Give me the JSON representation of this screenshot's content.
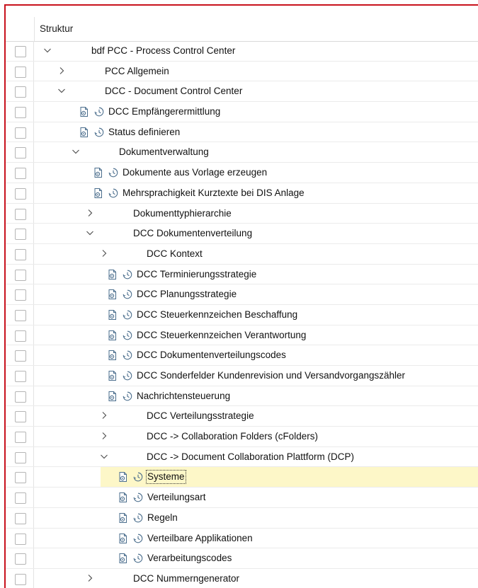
{
  "header": {
    "column_title": "Struktur"
  },
  "rows": [
    {
      "level": 0,
      "type": "folder",
      "expanded": true,
      "label": "bdf PCC - Process Control Center"
    },
    {
      "level": 1,
      "type": "folder",
      "expanded": false,
      "label": "PCC Allgemein"
    },
    {
      "level": 1,
      "type": "folder",
      "expanded": true,
      "label": "DCC - Document Control Center"
    },
    {
      "level": 2,
      "type": "activity",
      "label": "DCC Empfängerermittlung"
    },
    {
      "level": 2,
      "type": "activity",
      "label": "Status definieren"
    },
    {
      "level": 2,
      "type": "folder",
      "expanded": true,
      "label": "Dokumentverwaltung"
    },
    {
      "level": 3,
      "type": "activity",
      "label": "Dokumente aus Vorlage erzeugen"
    },
    {
      "level": 3,
      "type": "activity",
      "label": "Mehrsprachigkeit Kurztexte bei DIS Anlage"
    },
    {
      "level": 3,
      "type": "folder",
      "expanded": false,
      "label": "Dokumenttyphierarchie"
    },
    {
      "level": 3,
      "type": "folder",
      "expanded": true,
      "label": "DCC Dokumentenverteilung"
    },
    {
      "level": 4,
      "type": "folder",
      "expanded": false,
      "label": "DCC Kontext"
    },
    {
      "level": 4,
      "type": "activity",
      "label": "DCC Terminierungsstrategie"
    },
    {
      "level": 4,
      "type": "activity",
      "label": "DCC Planungsstrategie"
    },
    {
      "level": 4,
      "type": "activity",
      "label": "DCC Steuerkennzeichen Beschaffung"
    },
    {
      "level": 4,
      "type": "activity",
      "label": "DCC Steuerkennzeichen Verantwortung"
    },
    {
      "level": 4,
      "type": "activity",
      "label": "DCC Dokumentenverteilungscodes"
    },
    {
      "level": 4,
      "type": "activity",
      "label": "DCC Sonderfelder Kundenrevision und Versandvorgangszähler"
    },
    {
      "level": 4,
      "type": "activity",
      "label": "Nachrichtensteuerung"
    },
    {
      "level": 4,
      "type": "folder",
      "expanded": false,
      "label": "DCC Verteilungsstrategie"
    },
    {
      "level": 4,
      "type": "folder",
      "expanded": false,
      "label": "DCC -> Collaboration Folders (cFolders)"
    },
    {
      "level": 4,
      "type": "folder",
      "expanded": true,
      "label": "DCC -> Document Collaboration Plattform (DCP)"
    },
    {
      "level": 5,
      "type": "activity",
      "label": "Systeme",
      "selected": true
    },
    {
      "level": 5,
      "type": "activity",
      "label": "Verteilungsart"
    },
    {
      "level": 5,
      "type": "activity",
      "label": "Regeln"
    },
    {
      "level": 5,
      "type": "activity",
      "label": "Verteilbare Applikationen"
    },
    {
      "level": 5,
      "type": "activity",
      "label": "Verarbeitungscodes"
    },
    {
      "level": 3,
      "type": "folder",
      "expanded": false,
      "label": "DCC Nummerngenerator"
    }
  ],
  "icons": {
    "execute": "execute-activity-icon",
    "docu": "activity-documentation-icon",
    "expand": "chevron-right-icon",
    "collapse": "chevron-down-icon"
  },
  "colors": {
    "frame_border": "#c8121d",
    "selected_row": "#fdf7c8"
  }
}
